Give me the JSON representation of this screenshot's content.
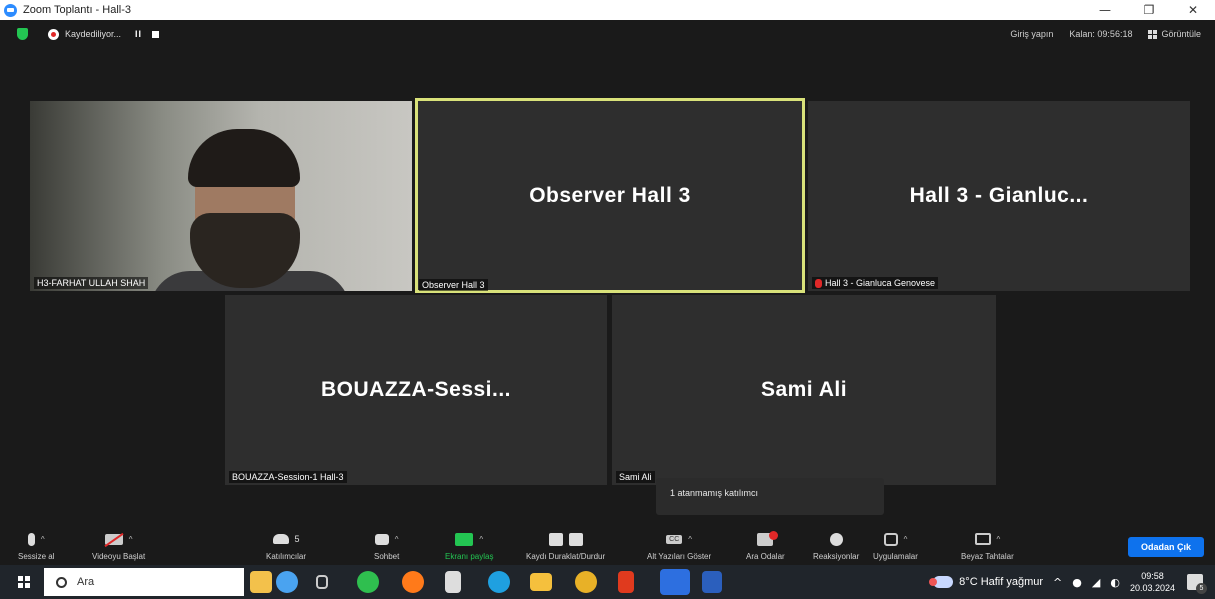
{
  "window": {
    "title": "Zoom Toplantı - Hall-3",
    "controls": [
      "—",
      "❐",
      "✕"
    ]
  },
  "meeting_top": {
    "recording_text": "Kaydediliyor...",
    "pause_glyph": "II",
    "info_link": "Giriş yapın",
    "remaining": "Kalan: 09:56:18",
    "view_label": "Görüntüle"
  },
  "tiles": [
    {
      "label": "H3-FARHAT ULLAH SHAH",
      "big_name": "",
      "video": true,
      "active": false,
      "muted": false
    },
    {
      "label": "Observer Hall 3",
      "big_name": "Observer Hall 3",
      "video": false,
      "active": true,
      "muted": false
    },
    {
      "label": "Hall 3 - Gianluca Genovese",
      "big_name": "Hall 3 - Gianluc...",
      "video": false,
      "active": false,
      "muted": true
    },
    {
      "label": "BOUAZZA-Session-1 Hall-3",
      "big_name": "BOUAZZA-Sessi...",
      "video": false,
      "active": false,
      "muted": false
    },
    {
      "label": "Sami Ali",
      "big_name": "Sami Ali",
      "video": false,
      "active": false,
      "muted": false
    }
  ],
  "tooltip": "1 atanmamış katılımcı",
  "toolbar": {
    "mute": "Sessize al",
    "video": "Videoyu Başlat",
    "participants": "Katılımcılar",
    "participants_count": "5",
    "chat": "Sohbet",
    "share": "Ekranı paylaş",
    "recording": "Kaydı Duraklat/Durdur",
    "captions": "Alt Yazıları Göster",
    "captions_icon": "CC",
    "breakout": "Ara Odalar",
    "reactions": "Reaksiyonlar",
    "apps": "Uygulamalar",
    "whiteboards": "Beyaz Tahtalar",
    "leave": "Odadan Çık"
  },
  "taskbar": {
    "search_placeholder": "Ara",
    "weather": "8°C  Hafif yağmur",
    "time": "09:58",
    "date": "20.03.2024",
    "notifications": "5"
  },
  "colors": {
    "active_border": "#d9e27a",
    "leave_button": "#0e72ed",
    "share_green": "#23c552",
    "tile_bg": "#2e2e2e"
  }
}
